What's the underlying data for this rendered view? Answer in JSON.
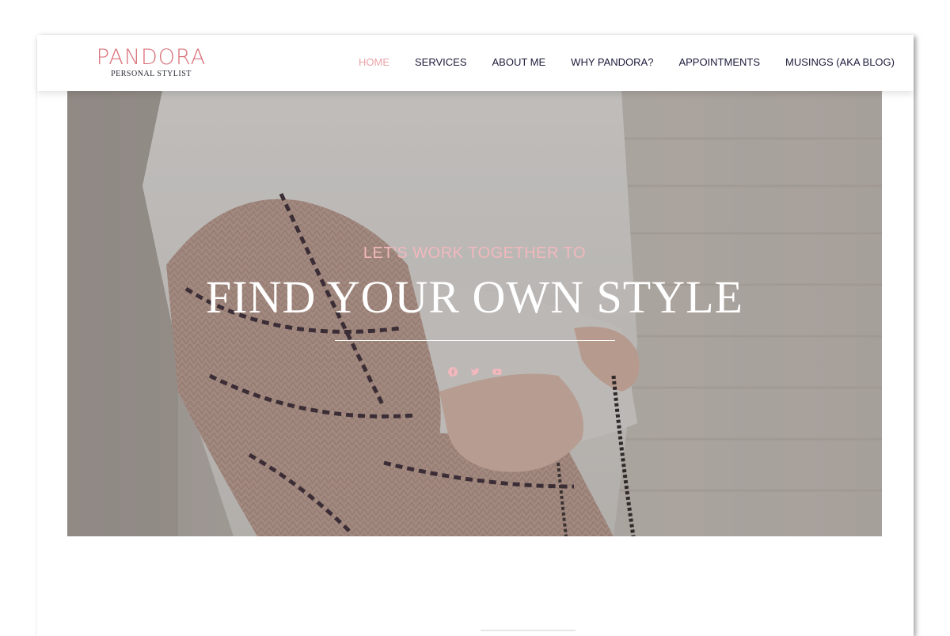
{
  "brand": {
    "title": "PANDORA",
    "subtitle": "PERSONAL STYLIST",
    "accent_color": "#d9737c"
  },
  "nav": {
    "items": [
      {
        "label": "HOME",
        "active": true
      },
      {
        "label": "SERVICES",
        "active": false
      },
      {
        "label": "ABOUT ME",
        "active": false
      },
      {
        "label": "WHY PANDORA?",
        "active": false
      },
      {
        "label": "APPOINTMENTS",
        "active": false
      },
      {
        "label": "MUSINGS (AKA BLOG)",
        "active": false
      }
    ],
    "active_color": "#e9a3a7",
    "text_color": "#1c1a3a"
  },
  "hero": {
    "kicker": "LET'S WORK TOGETHER TO",
    "heading": "FIND YOUR OWN STYLE",
    "kicker_color": "#f2b8bd",
    "social_icons": [
      "facebook-icon",
      "twitter-icon",
      "youtube-icon"
    ]
  }
}
